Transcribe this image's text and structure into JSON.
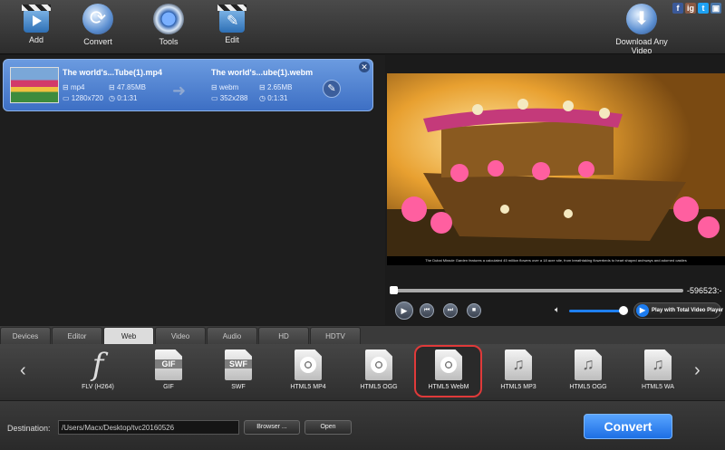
{
  "toolbar": {
    "add": "Add",
    "convert": "Convert",
    "tools": "Tools",
    "edit": "Edit",
    "download": "Download Any Video"
  },
  "social": [
    "f",
    "ig",
    "t",
    "▣"
  ],
  "file_item": {
    "source": {
      "title": "The world's...Tube(1).mp4",
      "format": "mp4",
      "size": "47.85MB",
      "resolution": "1280x720",
      "duration": "0:1:31"
    },
    "target": {
      "title": "The world's...ube(1).webm",
      "format": "webm",
      "size": "2.65MB",
      "resolution": "352x288",
      "duration": "0:1:31"
    }
  },
  "preview": {
    "caption": "The Dubai Miracle Garden features a calculated 45 million flowers over a 18 acre site, from breathtaking flowerbeds to heart shaped archways and adorned castles"
  },
  "player": {
    "time": "-596523:-",
    "play_with_total": "Play with Total Video Player"
  },
  "tabs": [
    "Devices",
    "Editor",
    "Web",
    "Video",
    "Audio",
    "HD",
    "HDTV"
  ],
  "active_tab": "Web",
  "formats": [
    {
      "label": "FLV (H264)",
      "icon": "flash-icon"
    },
    {
      "label": "GIF",
      "icon": "gif-file-icon",
      "badge": "GIF"
    },
    {
      "label": "SWF",
      "icon": "swf-file-icon",
      "badge": "SWF"
    },
    {
      "label": "HTML5 MP4",
      "icon": "film-reel-icon"
    },
    {
      "label": "HTML5 OGG",
      "icon": "film-reel-icon"
    },
    {
      "label": "HTML5 WebM",
      "icon": "film-reel-icon",
      "selected": true
    },
    {
      "label": "HTML5 MP3",
      "icon": "music-note-icon"
    },
    {
      "label": "HTML5 OGG",
      "icon": "music-note-icon"
    },
    {
      "label": "HTML5 WA",
      "icon": "music-note-icon"
    }
  ],
  "bottom": {
    "destination_label": "Destination:",
    "destination_path": "/Users/Macx/Desktop/tvc20160526",
    "browse": "Browser ...",
    "open": "Open",
    "convert": "Convert"
  },
  "colors": {
    "accent": "#1d6fe4",
    "selection_ring": "#e03a3a",
    "file_item_bg": "#4f83d4"
  }
}
